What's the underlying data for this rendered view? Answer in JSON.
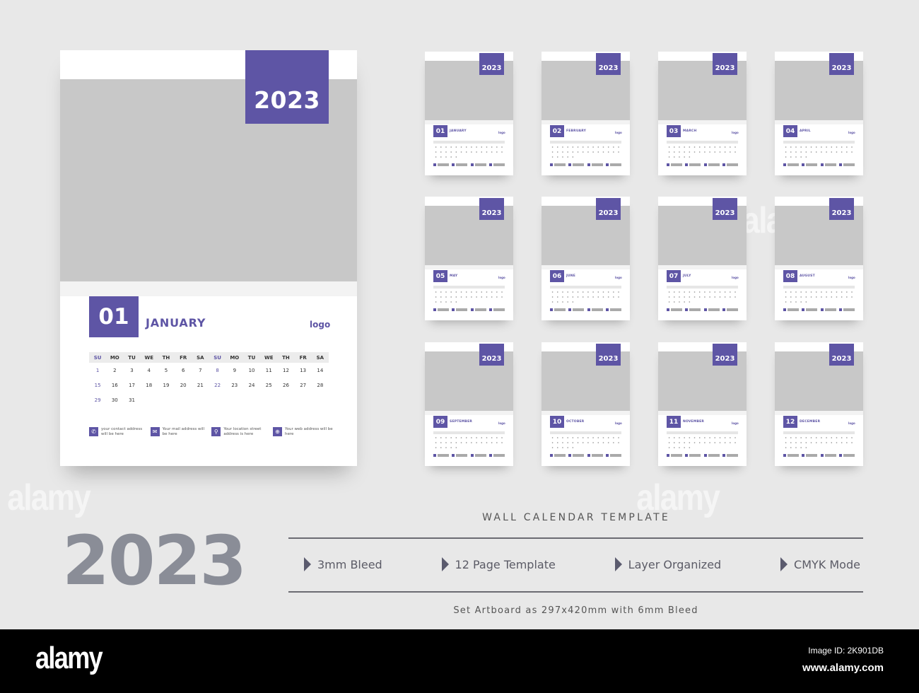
{
  "accent_color": "#5e55a5",
  "main_calendar": {
    "year": "2023",
    "month_number": "01",
    "month_name": "JANUARY",
    "logo": "logo",
    "weekdays": [
      "SU",
      "MO",
      "TU",
      "WE",
      "TH",
      "FR",
      "SA",
      "SU",
      "MO",
      "TU",
      "WE",
      "TH",
      "FR",
      "SA"
    ],
    "days": [
      "",
      "1",
      "2",
      "3",
      "4",
      "5",
      "6",
      "7",
      "8",
      "9",
      "10",
      "11",
      "12",
      "13",
      "14",
      "15",
      "16",
      "17",
      "18",
      "19",
      "20",
      "21",
      "22",
      "23",
      "24",
      "25",
      "26",
      "27",
      "28",
      "29",
      "30",
      "31"
    ],
    "contacts": [
      {
        "icon": "phone-icon",
        "glyph": "✆",
        "text": "your contact address will be here"
      },
      {
        "icon": "mail-icon",
        "glyph": "✉",
        "text": "Your mail address will be here"
      },
      {
        "icon": "location-pin-icon",
        "glyph": "⚲",
        "text": "Your location street address is here"
      },
      {
        "icon": "globe-icon",
        "glyph": "⊕",
        "text": "Your web address will be here"
      }
    ]
  },
  "thumbnails": [
    {
      "year": "2023",
      "number": "01",
      "name": "JANUARY",
      "logo": "logo"
    },
    {
      "year": "2023",
      "number": "02",
      "name": "FEBRUARY",
      "logo": "logo"
    },
    {
      "year": "2023",
      "number": "03",
      "name": "MARCH",
      "logo": "logo"
    },
    {
      "year": "2023",
      "number": "04",
      "name": "APRIL",
      "logo": "logo"
    },
    {
      "year": "2023",
      "number": "05",
      "name": "MAY",
      "logo": "logo"
    },
    {
      "year": "2023",
      "number": "06",
      "name": "JUNE",
      "logo": "logo"
    },
    {
      "year": "2023",
      "number": "07",
      "name": "JULY",
      "logo": "logo"
    },
    {
      "year": "2023",
      "number": "08",
      "name": "AUGUST",
      "logo": "logo"
    },
    {
      "year": "2023",
      "number": "09",
      "name": "SEPTEMBER",
      "logo": "logo"
    },
    {
      "year": "2023",
      "number": "10",
      "name": "OCTOBER",
      "logo": "logo"
    },
    {
      "year": "2023",
      "number": "11",
      "name": "NOVEMBER",
      "logo": "logo"
    },
    {
      "year": "2023",
      "number": "12",
      "name": "DECEMBER",
      "logo": "logo"
    }
  ],
  "info": {
    "big_year": "2023",
    "title": "WALL CALENDAR TEMPLATE",
    "features": [
      "3mm Bleed",
      "12 Page Template",
      "Layer Organized",
      "CMYK Mode"
    ],
    "artboard_note": "Set Artboard as 297x420mm with 6mm Bleed"
  },
  "footer": {
    "brand": "alamy",
    "image_id": "Image ID: 2K901DB",
    "url": "www.alamy.com"
  },
  "watermark": "alamy"
}
